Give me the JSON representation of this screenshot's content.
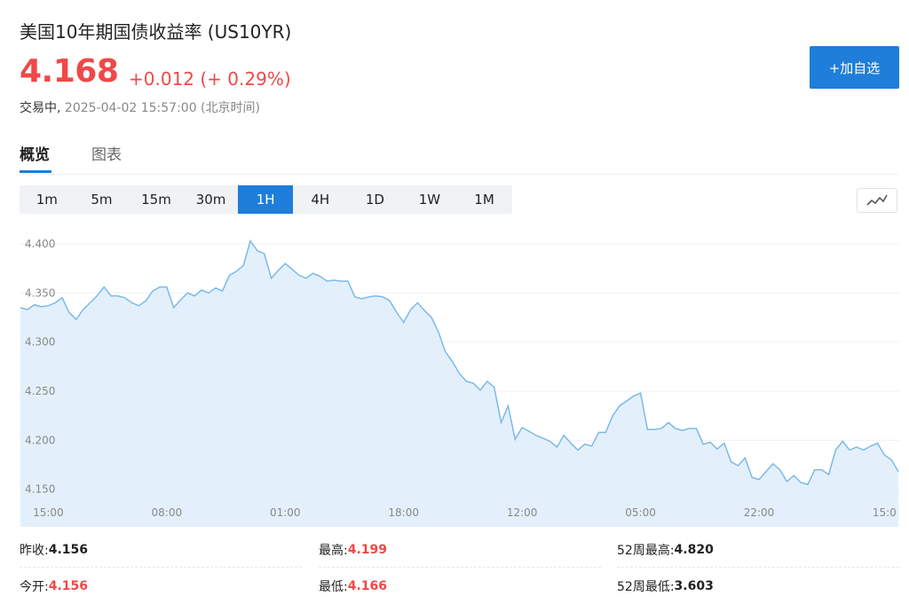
{
  "header": {
    "title": "美国10年期国债收益率 (US10YR)",
    "price": "4.168",
    "change": "+0.012 (+ 0.29%)",
    "status": "交易中,",
    "timestamp": "2025-04-02 15:57:00 (北京时间)",
    "add_button": "+加自选"
  },
  "tabs": [
    {
      "label": "概览",
      "active": true
    },
    {
      "label": "图表",
      "active": false
    }
  ],
  "ranges": [
    {
      "label": "1m"
    },
    {
      "label": "5m"
    },
    {
      "label": "15m"
    },
    {
      "label": "30m"
    },
    {
      "label": "1H",
      "active": true
    },
    {
      "label": "4H"
    },
    {
      "label": "1D"
    },
    {
      "label": "1W"
    },
    {
      "label": "1M"
    }
  ],
  "colors": {
    "accent": "#1e7ed9",
    "up": "#f04848",
    "line": "#7cb9e8",
    "area": "#e3f0fb"
  },
  "icons": {
    "chart_toggle": "line-chart-icon"
  },
  "chart_data": {
    "type": "area",
    "ylim": [
      4.138,
      4.418
    ],
    "yticks": [
      "4.400",
      "4.350",
      "4.300",
      "4.250",
      "4.200",
      "4.150"
    ],
    "ytick_values": [
      4.4,
      4.35,
      4.3,
      4.25,
      4.2,
      4.15
    ],
    "xticks": [
      {
        "label": "15:00",
        "index": 4
      },
      {
        "label": "08:00",
        "index": 21
      },
      {
        "label": "01:00",
        "index": 38
      },
      {
        "label": "18:00",
        "index": 55
      },
      {
        "label": "12:00",
        "index": 72
      },
      {
        "label": "05:00",
        "index": 89
      },
      {
        "label": "22:00",
        "index": 106
      },
      {
        "label": "15:0",
        "index": 124
      }
    ],
    "values": [
      4.335,
      4.333,
      4.338,
      4.336,
      4.337,
      4.34,
      4.345,
      4.33,
      4.323,
      4.333,
      4.34,
      4.347,
      4.356,
      4.347,
      4.347,
      4.345,
      4.34,
      4.337,
      4.342,
      4.352,
      4.356,
      4.356,
      4.335,
      4.343,
      4.35,
      4.347,
      4.353,
      4.35,
      4.355,
      4.352,
      4.368,
      4.372,
      4.378,
      4.403,
      4.393,
      4.39,
      4.365,
      4.373,
      4.38,
      4.374,
      4.368,
      4.365,
      4.37,
      4.367,
      4.362,
      4.363,
      4.362,
      4.362,
      4.346,
      4.344,
      4.346,
      4.347,
      4.346,
      4.342,
      4.33,
      4.32,
      4.333,
      4.34,
      4.332,
      4.325,
      4.31,
      4.29,
      4.28,
      4.268,
      4.26,
      4.258,
      4.251,
      4.26,
      4.254,
      4.218,
      4.235,
      4.201,
      4.213,
      4.209,
      4.205,
      4.202,
      4.199,
      4.193,
      4.205,
      4.197,
      4.19,
      4.196,
      4.194,
      4.208,
      4.208,
      4.225,
      4.235,
      4.24,
      4.245,
      4.248,
      4.211,
      4.211,
      4.212,
      4.218,
      4.212,
      4.21,
      4.212,
      4.212,
      4.196,
      4.198,
      4.191,
      4.197,
      4.178,
      4.174,
      4.182,
      4.162,
      4.16,
      4.168,
      4.176,
      4.17,
      4.158,
      4.164,
      4.157,
      4.155,
      4.17,
      4.17,
      4.165,
      4.19,
      4.199,
      4.19,
      4.193,
      4.19,
      4.194,
      4.197,
      4.185,
      4.18,
      4.168
    ]
  },
  "stats": [
    {
      "label": "昨收:",
      "value": "4.156",
      "color": "normal"
    },
    {
      "label": "最高:",
      "value": "4.199",
      "color": "red"
    },
    {
      "label": "52周最高:",
      "value": "4.820",
      "color": "normal"
    },
    {
      "label": "今开:",
      "value": "4.156",
      "color": "red"
    },
    {
      "label": "最低:",
      "value": "4.166",
      "color": "red"
    },
    {
      "label": "52周最低:",
      "value": "3.603",
      "color": "normal"
    }
  ]
}
